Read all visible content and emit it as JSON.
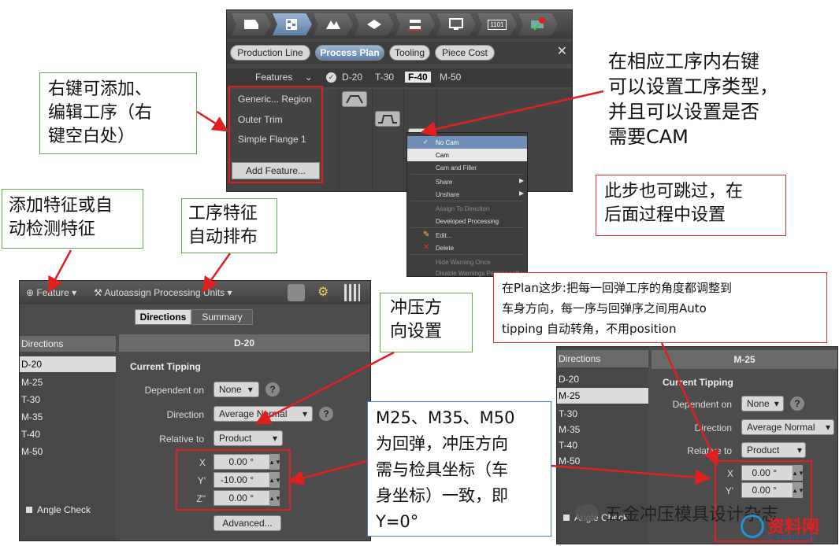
{
  "top_panel": {
    "tabs": [
      "Production Line",
      "Process Plan",
      "Tooling",
      "Piece Cost"
    ],
    "toolbar_badge": "1101",
    "features_label": "Features",
    "columns": [
      "D-20",
      "T-30",
      "F-40",
      "M-50"
    ],
    "features": [
      "Generic... Region",
      "Outer Trim",
      "Simple Flange 1"
    ],
    "add_feature": "Add Feature..."
  },
  "context_menu": {
    "items": [
      "No Cam",
      "Cam",
      "Cam and Filler",
      "Share",
      "Unshare",
      "Assign To Direction",
      "Developed Processing",
      "Edit...",
      "Delete",
      "Hide Warning Once",
      "Disable Warnings Permanently"
    ]
  },
  "notes": {
    "right_click": "右键可添加、编辑工序（右键空白处）",
    "right_click_lines": [
      "右键可添加、",
      "编辑工序（右",
      "键空白处）"
    ],
    "set_type_lines": [
      "在相应工序内右键",
      "可以设置工序类型，",
      "并且可以设置是否",
      "需要CAM"
    ],
    "skip_lines": [
      "此步也可跳过，在",
      "后面过程中设置"
    ],
    "add_feature_lines": [
      "添加特征或自",
      "动检测特征"
    ],
    "auto_arrange_lines": [
      "工序特征",
      "自动排布"
    ],
    "direction_lines": [
      "冲压方",
      "向设置"
    ],
    "plan_lines": [
      "在Plan这步:把每一回弹工序的角度都调整到",
      "车身方向，每一序与回弹序之间用Auto",
      "tipping 自动转角，不用position"
    ],
    "springback_lines": [
      "M25、M35、M50",
      "为回弹，冲压方向",
      "需与检具坐标（车",
      "身坐标）一致，即",
      "Y=0°"
    ]
  },
  "left_panel": {
    "feature_menu": "Feature",
    "autoassign": "Autoassign Processing Units",
    "seg_directions": "Directions",
    "seg_summary": "Summary",
    "directions_head": "Directions",
    "directions": [
      "D-20",
      "M-25",
      "T-30",
      "M-35",
      "T-40",
      "M-50"
    ],
    "selected_title": "D-20",
    "current_tipping": "Current Tipping",
    "dependent_on_label": "Dependent on",
    "dependent_on_value": "None",
    "direction_label": "Direction",
    "direction_value": "Average Normal",
    "relative_to_label": "Relative to",
    "relative_to_value": "Product",
    "x_label": "X",
    "y_label": "Y'",
    "z_label": "Z\"",
    "x_value": "0.00 °",
    "y_value": "-10.00 °",
    "z_value": "0.00 °",
    "angle_check": "Angle Check",
    "advanced": "Advanced..."
  },
  "right_panel": {
    "directions_head": "Directions",
    "directions": [
      "D-20",
      "M-25",
      "T-30",
      "M-35",
      "T-40",
      "M-50"
    ],
    "selected_title": "M-25",
    "current_tipping": "Current Tipping",
    "dependent_on_label": "Dependent on",
    "dependent_on_value": "None",
    "direction_label": "Direction",
    "direction_value": "Average Normal",
    "relative_to_label": "Relative to",
    "relative_to_value": "Product",
    "x_label": "X",
    "y_label": "Y'",
    "x_value": "0.00 °",
    "y_value": "0.00 °",
    "angle_check": "Angle Check"
  },
  "watermark": {
    "text": "五金冲压模具设计杂志",
    "logo_text": "资料网",
    "logo_url": "ZL.XS1616.COM"
  },
  "colors": {
    "annotation_red": "#e02020",
    "note_green": "#6aa84f",
    "note_blue": "#3c7dc4"
  }
}
